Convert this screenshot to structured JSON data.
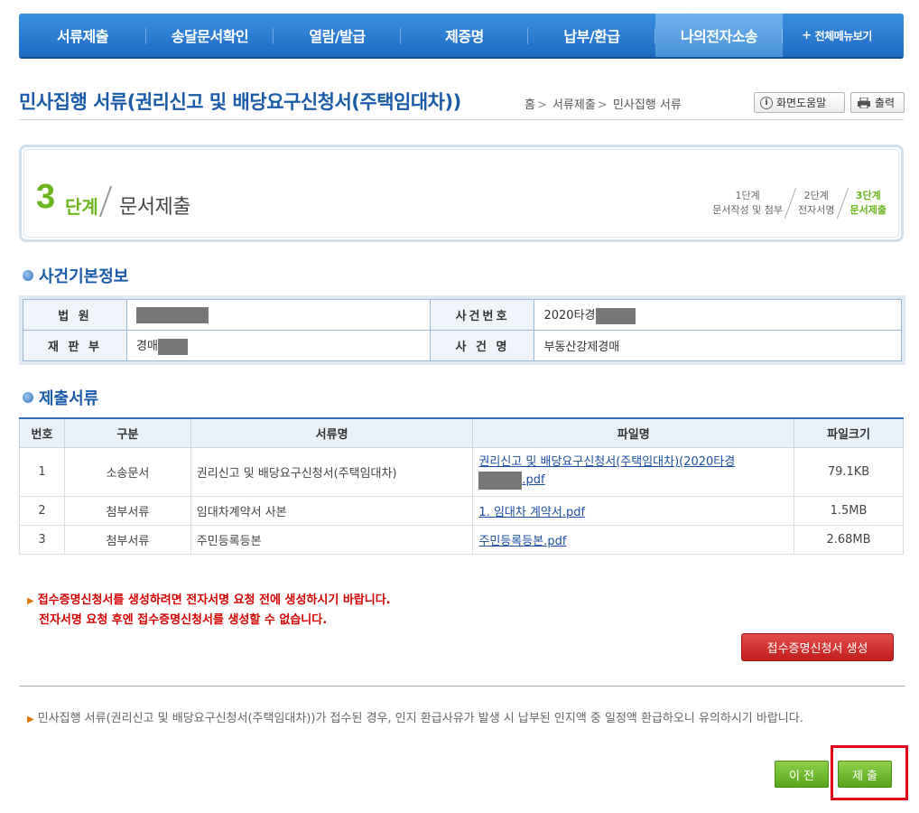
{
  "nav": {
    "items": [
      "서류제출",
      "송달문서확인",
      "열람/발급",
      "제증명",
      "납부/환급",
      "나의전자소송"
    ],
    "all_plus": "+",
    "all_label": "전체메뉴보기"
  },
  "header": {
    "title": "민사집행 서류(권리신고 및 배당요구신청서(주택임대차))",
    "breadcrumb": [
      "홈",
      "서류제출",
      "민사집행 서류"
    ],
    "breadcrumb_sep": ">",
    "help_label": "화면도움말",
    "print_label": "출력"
  },
  "step": {
    "number": "3",
    "unit": "단계",
    "name": "문서제출",
    "mini": [
      {
        "step": "1단계",
        "desc": "문서작성 및 첨부"
      },
      {
        "step": "2단계",
        "desc": "전자서명"
      },
      {
        "step": "3단계",
        "desc": "문서제출"
      }
    ]
  },
  "case_info": {
    "heading": "사건기본정보",
    "court_label": "법 원",
    "case_no_label": "사건번호",
    "case_no_prefix": "2020타경",
    "division_label": "재 판 부",
    "division_prefix": "경매",
    "case_name_label": "사 건 명",
    "case_name": "부동산강제경매"
  },
  "docs": {
    "heading": "제출서류",
    "columns": [
      "번호",
      "구분",
      "서류명",
      "파일명",
      "파일크기"
    ],
    "rows": [
      {
        "no": "1",
        "type": "소송문서",
        "name": "권리신고 및 배당요구신청서(주택임대차)",
        "file_a": "권리신고 및 배당요구신청서(주택임대차)(2020타경",
        "file_b": ".pdf",
        "size": "79.1KB"
      },
      {
        "no": "2",
        "type": "첨부서류",
        "name": "임대차계약서 사본",
        "file": "1. 임대차 계약서.pdf",
        "size": "1.5MB"
      },
      {
        "no": "3",
        "type": "첨부서류",
        "name": "주민등록등본",
        "file": "주민등록등본.pdf",
        "size": "2.68MB"
      }
    ]
  },
  "notices": {
    "arrow": "▶",
    "warn_line1": "접수증명신청서를 생성하려면 전자서명 요청 전에 생성하시기 바랍니다.",
    "warn_line2": "전자서명 요청 후엔 접수증명신청서를 생성할 수 없습니다.",
    "create_button": "접수증명신청서 생성",
    "info": "민사집행 서류(권리신고 및 배당요구신청서(주택임대차))가 접수된 경우, 인지 환급사유가 발생 시 납부된 인지액 중 일정액 환급하오니 유의하시기 바랍니다."
  },
  "actions": {
    "prev_label": "이 전",
    "submit_label": "제 출"
  }
}
